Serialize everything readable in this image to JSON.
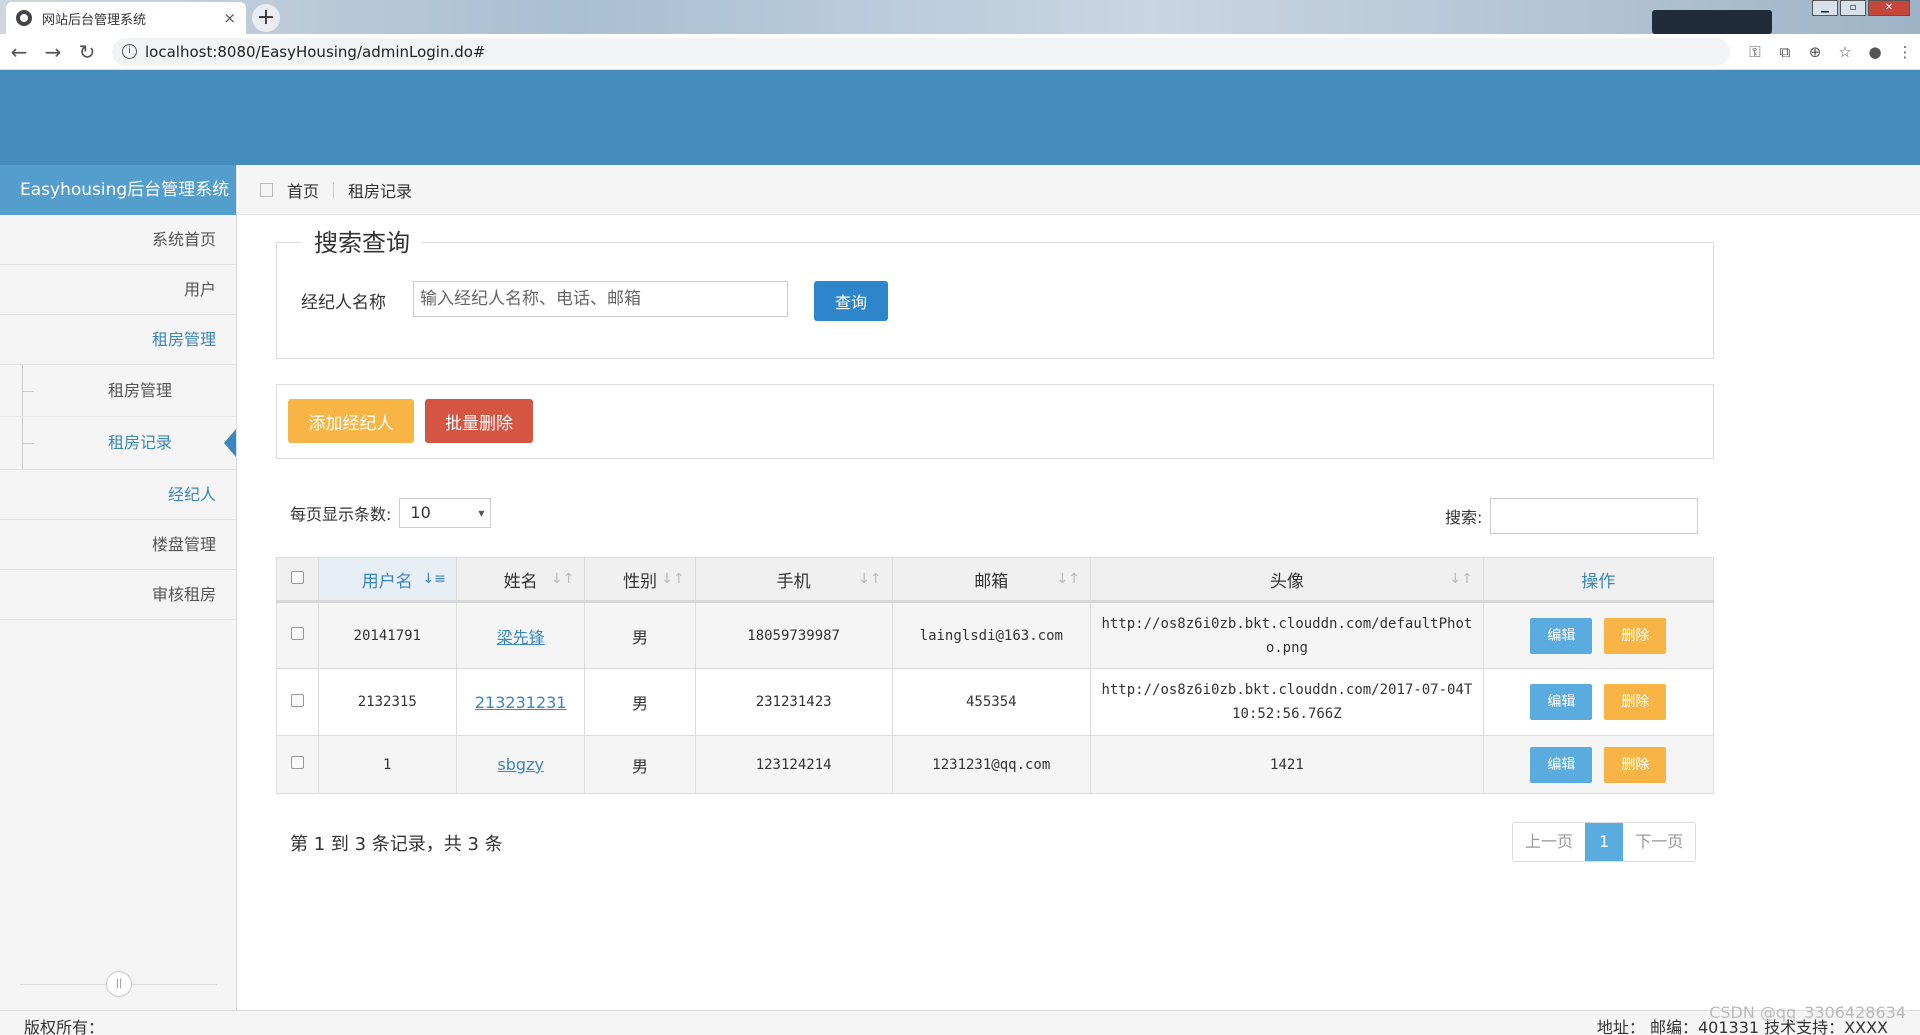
{
  "browser": {
    "tab_title": "网站后台管理系统",
    "tab_close": "×",
    "new_tab": "+",
    "url": "localhost:8080/EasyHousing/adminLogin.do#",
    "back": "←",
    "forward": "→",
    "reload": "↻",
    "info": "i",
    "window_controls": [
      "▁",
      "▫",
      "✕"
    ]
  },
  "sidebar": {
    "brand": "Easyhousing后台管理系统",
    "items": [
      {
        "label": "系统首页"
      },
      {
        "label": "用户"
      },
      {
        "label": "租房管理"
      },
      {
        "label": "经纪人"
      },
      {
        "label": "楼盘管理"
      },
      {
        "label": "审核租房"
      }
    ],
    "subitems": [
      {
        "label": "租房管理"
      },
      {
        "label": "租房记录"
      }
    ]
  },
  "breadcrumb": {
    "home": "首页",
    "current": "租房记录"
  },
  "search": {
    "legend": "搜索查询",
    "label": "经纪人名称",
    "placeholder": "输入经纪人名称、电话、邮箱",
    "button": "查询"
  },
  "actions": {
    "add": "添加经纪人",
    "batch_delete": "批量删除"
  },
  "table_controls": {
    "page_size_label": "每页显示条数:",
    "page_size_value": "10",
    "search_label": "搜索:"
  },
  "table": {
    "headers": [
      "用户名",
      "姓名",
      "性别",
      "手机",
      "邮箱",
      "头像",
      "操作"
    ],
    "rows": [
      {
        "username": "20141791",
        "name": "梁先锋",
        "gender": "男",
        "phone": "18059739987",
        "email": "lainglsdi@163.com",
        "photo": "http://os8z6i0zb.bkt.clouddn.com/defaultPhoto.png"
      },
      {
        "username": "2132315",
        "name": "213231231",
        "gender": "男",
        "phone": "231231423",
        "email": "455354",
        "photo": "http://os8z6i0zb.bkt.clouddn.com/2017-07-04T10:52:56.766Z"
      },
      {
        "username": "1",
        "name": "sbgzy",
        "gender": "男",
        "phone": "123124214",
        "email": "1231231@qq.com",
        "photo": "1421"
      }
    ],
    "edit_label": "编辑",
    "delete_label": "删除"
  },
  "pagination": {
    "info": "第 1 到 3 条记录，共 3 条",
    "prev": "上一页",
    "current": "1",
    "next": "下一页"
  },
  "footer": {
    "left": "版权所有：",
    "right": "地址：   邮编：401331 技术支持：XXXX"
  },
  "watermark": "CSDN @qq_3306428634"
}
